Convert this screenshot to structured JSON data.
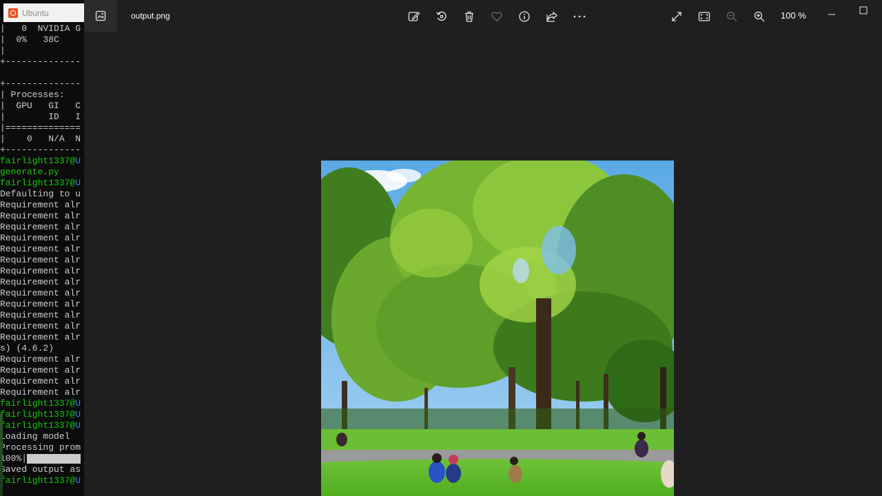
{
  "terminal": {
    "window_title": "Ubuntu",
    "lines": [
      {
        "text": "|   0  NVIDIA G",
        "style": "normal"
      },
      {
        "text": "|  0%   38C",
        "style": "normal"
      },
      {
        "text": "|",
        "style": "normal"
      },
      {
        "text": "+--------------",
        "style": "normal"
      },
      {
        "text": "",
        "style": "normal"
      },
      {
        "text": "+--------------",
        "style": "normal"
      },
      {
        "text": "| Processes:",
        "style": "normal"
      },
      {
        "text": "|  GPU   GI   C",
        "style": "normal"
      },
      {
        "text": "|        ID   I",
        "style": "normal"
      },
      {
        "text": "|==============",
        "style": "normal"
      },
      {
        "text": "|    0   N/A  N",
        "style": "normal"
      },
      {
        "text": "+--------------",
        "style": "normal"
      },
      {
        "text": "fairlight1337@",
        "host": "U",
        "style": "prompt"
      },
      {
        "text": "generate.py",
        "style": "green"
      },
      {
        "text": "fairlight1337@",
        "host": "U",
        "style": "prompt"
      },
      {
        "text": "Defaulting to u",
        "style": "normal"
      },
      {
        "text": "Requirement alr",
        "style": "normal"
      },
      {
        "text": "Requirement alr",
        "style": "normal"
      },
      {
        "text": "Requirement alr",
        "style": "normal"
      },
      {
        "text": "Requirement alr",
        "style": "normal"
      },
      {
        "text": "Requirement alr",
        "style": "normal"
      },
      {
        "text": "Requirement alr",
        "style": "normal"
      },
      {
        "text": "Requirement alr",
        "style": "normal"
      },
      {
        "text": "Requirement alr",
        "style": "normal"
      },
      {
        "text": "Requirement alr",
        "style": "normal"
      },
      {
        "text": "Requirement alr",
        "style": "normal"
      },
      {
        "text": "Requirement alr",
        "style": "normal"
      },
      {
        "text": "Requirement alr",
        "style": "normal"
      },
      {
        "text": "Requirement alr",
        "style": "normal"
      },
      {
        "text": "s) (4.6.2)",
        "style": "normal"
      },
      {
        "text": "Requirement alr",
        "style": "normal"
      },
      {
        "text": "Requirement alr",
        "style": "normal"
      },
      {
        "text": "Requirement alr",
        "style": "normal"
      },
      {
        "text": "Requirement alr",
        "style": "normal"
      },
      {
        "text": "fairlight1337@",
        "host": "U",
        "style": "prompt"
      },
      {
        "text": "fairlight1337@",
        "host": "U",
        "style": "prompt"
      },
      {
        "text": "fairlight1337@",
        "host": "U",
        "style": "prompt"
      },
      {
        "text": "Loading model",
        "style": "normal"
      },
      {
        "text": "Processing prom",
        "style": "normal"
      },
      {
        "text": "100%|",
        "style": "progress"
      },
      {
        "text": "Saved output as",
        "style": "normal"
      },
      {
        "text": "fairlight1337@",
        "host": "U",
        "style": "prompt"
      }
    ]
  },
  "viewer": {
    "file_name": "output.png",
    "zoom_level": "100 %",
    "toolbar": [
      {
        "name": "edit-image-icon"
      },
      {
        "name": "rotate-icon"
      },
      {
        "name": "delete-icon"
      },
      {
        "name": "favorite-icon"
      },
      {
        "name": "file-info-icon"
      },
      {
        "name": "share-icon"
      },
      {
        "name": "more-options-icon"
      }
    ],
    "right_toolbar": [
      {
        "name": "full-screen-icon"
      },
      {
        "name": "fit-to-window-icon"
      },
      {
        "name": "zoom-out-icon"
      },
      {
        "name": "zoom-in-icon"
      }
    ],
    "colors": {
      "background": "#1f1f1f",
      "toolbar_icon": "#e6e6e6",
      "disabled_icon": "#6b6b6b"
    }
  }
}
